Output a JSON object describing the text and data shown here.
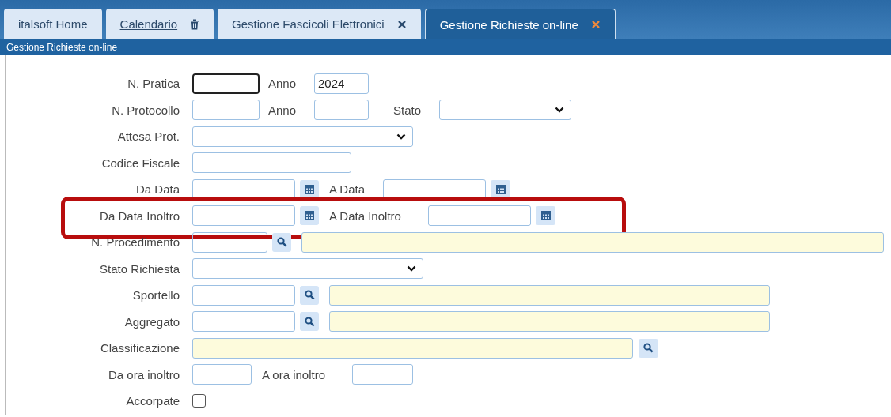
{
  "tabs": [
    {
      "label": "italsoft Home",
      "selected": false,
      "link": false
    },
    {
      "label": "Calendario",
      "selected": false,
      "link": true,
      "kind": "trash"
    },
    {
      "label": "Gestione Fascicoli Elettronici",
      "selected": false,
      "link": false,
      "kind": "close"
    },
    {
      "label": "Gestione Richieste on-line",
      "selected": true,
      "link": false,
      "kind": "close"
    }
  ],
  "panel_title": "Gestione Richieste on-line",
  "form": [
    {
      "label": "N. Pratica",
      "highlighted": false,
      "items": [
        {
          "kind": "input",
          "focused": true
        },
        {
          "kind": "label",
          "text": "Anno"
        },
        {
          "kind": "input",
          "value": "2024",
          "focused": false
        }
      ]
    },
    {
      "label": "N. Protocollo",
      "highlighted": false,
      "items": [
        {
          "kind": "input",
          "focused": false
        },
        {
          "kind": "label",
          "text": "Anno"
        },
        {
          "kind": "input",
          "focused": false
        },
        {
          "kind": "label",
          "text": "Stato"
        },
        {
          "kind": "select"
        }
      ]
    },
    {
      "label": "Attesa Prot.",
      "highlighted": false,
      "items": [
        {
          "kind": "select"
        }
      ]
    },
    {
      "label": "Codice Fiscale",
      "highlighted": false,
      "items": [
        {
          "kind": "input",
          "focused": false
        }
      ]
    },
    {
      "label": "Da Data",
      "highlighted": false,
      "items": [
        {
          "kind": "input",
          "focused": false
        },
        {
          "kind": "calendar"
        },
        {
          "kind": "label",
          "text": "A Data"
        },
        {
          "kind": "input",
          "focused": false
        },
        {
          "kind": "calendar"
        }
      ]
    },
    {
      "label": "Da Data Inoltro",
      "highlighted": true,
      "items": [
        {
          "kind": "input",
          "focused": false
        },
        {
          "kind": "calendar"
        },
        {
          "kind": "label",
          "text": "A Data Inoltro"
        },
        {
          "kind": "input",
          "focused": false
        },
        {
          "kind": "calendar"
        }
      ]
    },
    {
      "label": "N. Procedimento",
      "highlighted": false,
      "items": [
        {
          "kind": "input",
          "focused": false
        },
        {
          "kind": "lookup"
        },
        {
          "kind": "description"
        }
      ]
    },
    {
      "label": "Stato Richiesta",
      "highlighted": false,
      "items": [
        {
          "kind": "select"
        }
      ]
    },
    {
      "label": "Sportello",
      "highlighted": false,
      "items": [
        {
          "kind": "input",
          "focused": false
        },
        {
          "kind": "lookup"
        },
        {
          "kind": "description"
        }
      ]
    },
    {
      "label": "Aggregato",
      "highlighted": false,
      "items": [
        {
          "kind": "input",
          "focused": false
        },
        {
          "kind": "lookup"
        },
        {
          "kind": "description"
        }
      ]
    },
    {
      "label": "Classificazione",
      "highlighted": false,
      "items": [
        {
          "kind": "description"
        },
        {
          "kind": "lookup"
        }
      ]
    },
    {
      "label": "Da ora inoltro",
      "highlighted": false,
      "items": [
        {
          "kind": "input",
          "focused": false
        },
        {
          "kind": "label",
          "text": "A ora inoltro"
        },
        {
          "kind": "input",
          "focused": false
        }
      ]
    },
    {
      "label": "Accorpate",
      "highlighted": false,
      "items": [
        {
          "kind": "checkbox",
          "checked": false
        }
      ]
    }
  ]
}
